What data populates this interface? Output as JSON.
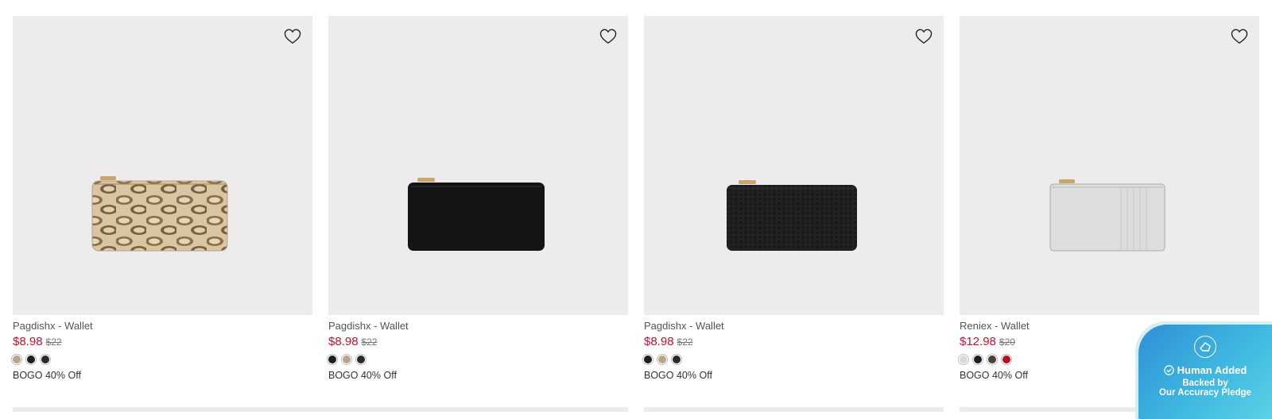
{
  "products": [
    {
      "name": "Pagdishx - Wallet",
      "price": "$8.98",
      "was_price": "$22",
      "promo": "BOGO 40% Off",
      "product_icon": "snakeskin-wallet",
      "swatches": [
        {
          "color": "#b8a58a",
          "name": "beige"
        },
        {
          "color": "#1e1e1e",
          "name": "black"
        },
        {
          "color": "#2a2a2a",
          "name": "black"
        }
      ]
    },
    {
      "name": "Pagdishx - Wallet",
      "price": "$8.98",
      "was_price": "$22",
      "promo": "BOGO 40% Off",
      "product_icon": "black-wallet",
      "swatches": [
        {
          "color": "#1e1e1e",
          "name": "black"
        },
        {
          "color": "#b8a58a",
          "name": "beige"
        },
        {
          "color": "#2a2a2a",
          "name": "black"
        }
      ]
    },
    {
      "name": "Pagdishx - Wallet",
      "price": "$8.98",
      "was_price": "$22",
      "promo": "BOGO 40% Off",
      "product_icon": "black-croc-wallet",
      "swatches": [
        {
          "color": "#1e1e1e",
          "name": "black"
        },
        {
          "color": "#b8a58a",
          "name": "beige"
        },
        {
          "color": "#2a2a2a",
          "name": "black"
        }
      ]
    },
    {
      "name": "Reniex - Wallet",
      "price": "$12.98",
      "was_price": "$20",
      "promo": "BOGO 40% Off",
      "product_icon": "white-cardholder",
      "swatches": [
        {
          "color": "#d9d9d6",
          "name": "white"
        },
        {
          "color": "#1e1e1e",
          "name": "black"
        },
        {
          "color": "#4a4036",
          "name": "brown"
        },
        {
          "color": "#b3121c",
          "name": "red"
        }
      ]
    }
  ],
  "badge": {
    "title": "Human Added",
    "line1": "Backed by",
    "line2": "Our Accuracy Pledge"
  },
  "colors": {
    "price": "#c8102e",
    "card_bg": "#edebee",
    "badge_start": "#2f8fd6",
    "badge_end": "#5ad2e6"
  }
}
